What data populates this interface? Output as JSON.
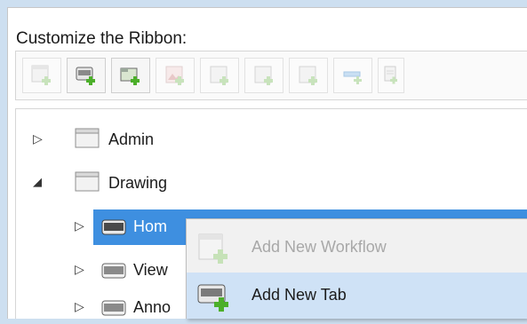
{
  "heading": "Customize the Ribbon:",
  "toolbar": {
    "buttons": [
      {
        "name": "add-workflow-button",
        "state": "disabled"
      },
      {
        "name": "add-tab-button",
        "state": "enabled"
      },
      {
        "name": "add-panel-button",
        "state": "enabled"
      },
      {
        "name": "add-image-button",
        "state": "disabled"
      },
      {
        "name": "add-command-button",
        "state": "disabled"
      },
      {
        "name": "add-subpanel-button",
        "state": "disabled"
      },
      {
        "name": "add-split-button",
        "state": "disabled"
      },
      {
        "name": "add-separator-button",
        "state": "disabled"
      },
      {
        "name": "add-document-button",
        "state": "disabled"
      }
    ]
  },
  "tree": {
    "items": [
      {
        "label": "Admin",
        "expander": "collapsed"
      },
      {
        "label": "Drawing",
        "expander": "expanded"
      },
      {
        "label": "Hom",
        "expander": "collapsed",
        "selected": true
      },
      {
        "label": "View",
        "expander": "collapsed"
      },
      {
        "label": "Anno",
        "expander": "collapsed"
      }
    ]
  },
  "context_menu": {
    "items": [
      {
        "label": "Add New Workflow",
        "enabled": false
      },
      {
        "label": "Add New Tab",
        "enabled": true,
        "hover": true
      }
    ]
  },
  "colors": {
    "selection": "#3e8fe0",
    "menu_hover": "#cfe2f6",
    "plus_green": "#4caf2a"
  }
}
